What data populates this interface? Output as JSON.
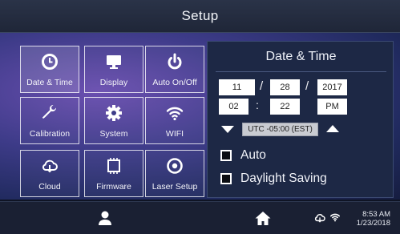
{
  "header": {
    "title": "Setup"
  },
  "tiles": [
    {
      "label": "Date & Time",
      "icon": "clock-icon"
    },
    {
      "label": "Display",
      "icon": "monitor-icon"
    },
    {
      "label": "Auto On/Off",
      "icon": "power-icon"
    },
    {
      "label": "Calibration",
      "icon": "wrench-icon"
    },
    {
      "label": "System",
      "icon": "gear-icon"
    },
    {
      "label": "WIFI",
      "icon": "wifi-icon"
    },
    {
      "label": "Cloud",
      "icon": "cloud-icon"
    },
    {
      "label": "Firmware",
      "icon": "chip-icon"
    },
    {
      "label": "Laser Setup",
      "icon": "target-icon"
    }
  ],
  "date_time": {
    "title": "Date & Time",
    "date": {
      "month": "11",
      "day": "28",
      "year": "2017",
      "separator": "/"
    },
    "time": {
      "hour": "02",
      "minute": "22",
      "ampm": "PM",
      "separator": ":"
    },
    "timezone": "UTC -05:00 (EST)",
    "auto_label": "Auto",
    "dst_label": "Daylight Saving"
  },
  "footer": {
    "icons": [
      "user-icon",
      "home-icon",
      "cloud-icon",
      "wifi-icon"
    ],
    "time": "8:53 AM",
    "date": "1/23/2018"
  },
  "colors": {
    "header_bg": "#252d42",
    "panel_bg": "#1d2845",
    "footer_bg": "#1a2033",
    "background_accent": "#6a4fb0"
  }
}
